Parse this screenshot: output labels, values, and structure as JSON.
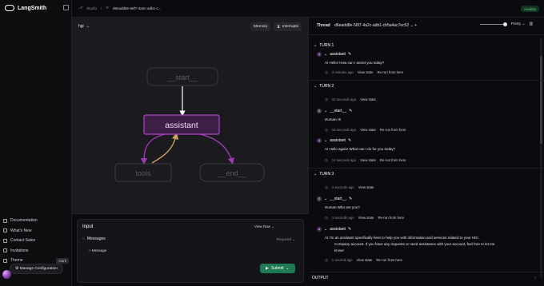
{
  "brand": {
    "name": "LangSmith"
  },
  "breadcrumb": {
    "root": "Studio",
    "thread": "d6eadd8e-56f7-4a2c-adb1-c..."
  },
  "status": {
    "label": "Healthy"
  },
  "graph": {
    "selector": "hgi",
    "memory": "Memory",
    "interrupts": "Interrupts",
    "nodes": {
      "start": "__start__",
      "assistant": "assistant",
      "tools": "tools",
      "end": "__end__"
    }
  },
  "input": {
    "title": "Input",
    "view_raw": "View Raw",
    "messages": "Messages",
    "required": "Required",
    "add_message": "+ Message",
    "manage": "Manage Configuration",
    "submit": "Submit"
  },
  "nav": {
    "items": [
      "Documentation",
      "What's New",
      "Contact Sales",
      "Invitations",
      "Theme"
    ],
    "theme_value": "Dark"
  },
  "thread": {
    "label": "Thread",
    "id": "d6eadd8e-56f7-4a2c-adb1-cb5a4ac7ec52",
    "view_mode": "Pretty",
    "output": "OUTPUT",
    "turn1": {
      "title": "TURN 1",
      "node": "assistant",
      "msg": "AI  Hello! How can I assist you today?",
      "time": "3 minutes ago",
      "view": "View state",
      "rerun": "Re-run from here"
    },
    "turn2": {
      "title": "TURN 2",
      "t0": "10 seconds ago",
      "v0": "View state",
      "node1": "__start__",
      "msg1": "Human  Hi",
      "t1": "15 seconds ago",
      "v1": "View state",
      "r1": "Re-run from here",
      "node2": "assistant",
      "msg2": "AI  Hello again! What can I do for you today?",
      "t2": "14 seconds ago",
      "v2": "View state",
      "r2": "Re-run from here"
    },
    "turn3": {
      "title": "TURN 3",
      "t0": "3 seconds ago",
      "v0": "View state",
      "node1": "__start__",
      "msg1": "Human  Who are you?",
      "t1": "3 seconds ago",
      "v1": "View state",
      "r1": "Re-run from here",
      "node2": "assistant",
      "msg2a": "AI  I'm an assistant specifically here to help you with information and services related to your HGI",
      "msg2b": "Company account. If you have any requests or need assistance with your account, feel free to let me",
      "msg2c": "know!",
      "t2": "1 second ago",
      "v2": "View state",
      "r2": "Re-run from here"
    }
  }
}
